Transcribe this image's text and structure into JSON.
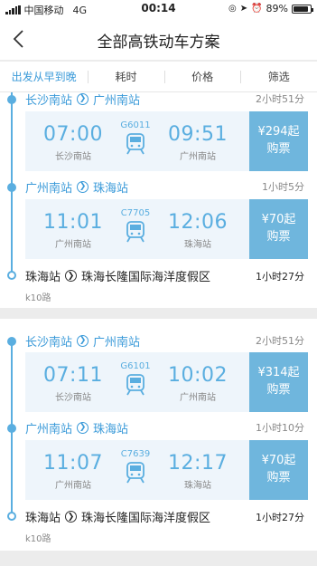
{
  "status_bar": {
    "carrier": "中国移动",
    "network": "4G",
    "time": "00:14",
    "battery": "89%",
    "battery_level": 0.89
  },
  "nav": {
    "title": "全部高铁动车方案"
  },
  "tabs": [
    "出发从早到晚",
    "耗时",
    "价格",
    "筛选"
  ],
  "plans": [
    {
      "legs": [
        {
          "from": "长沙南站",
          "to": "广州南站",
          "duration": "2小时51分",
          "dep_time": "07:00",
          "dep_station": "长沙南站",
          "train": "G6011",
          "arr_time": "09:51",
          "arr_station": "广州南站",
          "price": "¥294起",
          "buy": "购票"
        },
        {
          "from": "广州南站",
          "to": "珠海站",
          "duration": "1小时5分",
          "dep_time": "11:01",
          "dep_station": "广州南站",
          "train": "C7705",
          "arr_time": "12:06",
          "arr_station": "珠海站",
          "price": "¥70起",
          "buy": "购票"
        }
      ],
      "final": {
        "from": "珠海站",
        "to": "珠海长隆国际海洋度假区",
        "duration": "1小时27分",
        "bus": "k10路"
      }
    },
    {
      "legs": [
        {
          "from": "长沙南站",
          "to": "广州南站",
          "duration": "2小时51分",
          "dep_time": "07:11",
          "dep_station": "长沙南站",
          "train": "G6101",
          "arr_time": "10:02",
          "arr_station": "广州南站",
          "price": "¥314起",
          "buy": "购票"
        },
        {
          "from": "广州南站",
          "to": "珠海站",
          "duration": "1小时10分",
          "dep_time": "11:07",
          "dep_station": "广州南站",
          "train": "C7639",
          "arr_time": "12:17",
          "arr_station": "珠海站",
          "price": "¥70起",
          "buy": "购票"
        }
      ],
      "final": {
        "from": "珠海站",
        "to": "珠海长隆国际海洋度假区",
        "duration": "1小时27分",
        "bus": "k10路"
      }
    }
  ]
}
